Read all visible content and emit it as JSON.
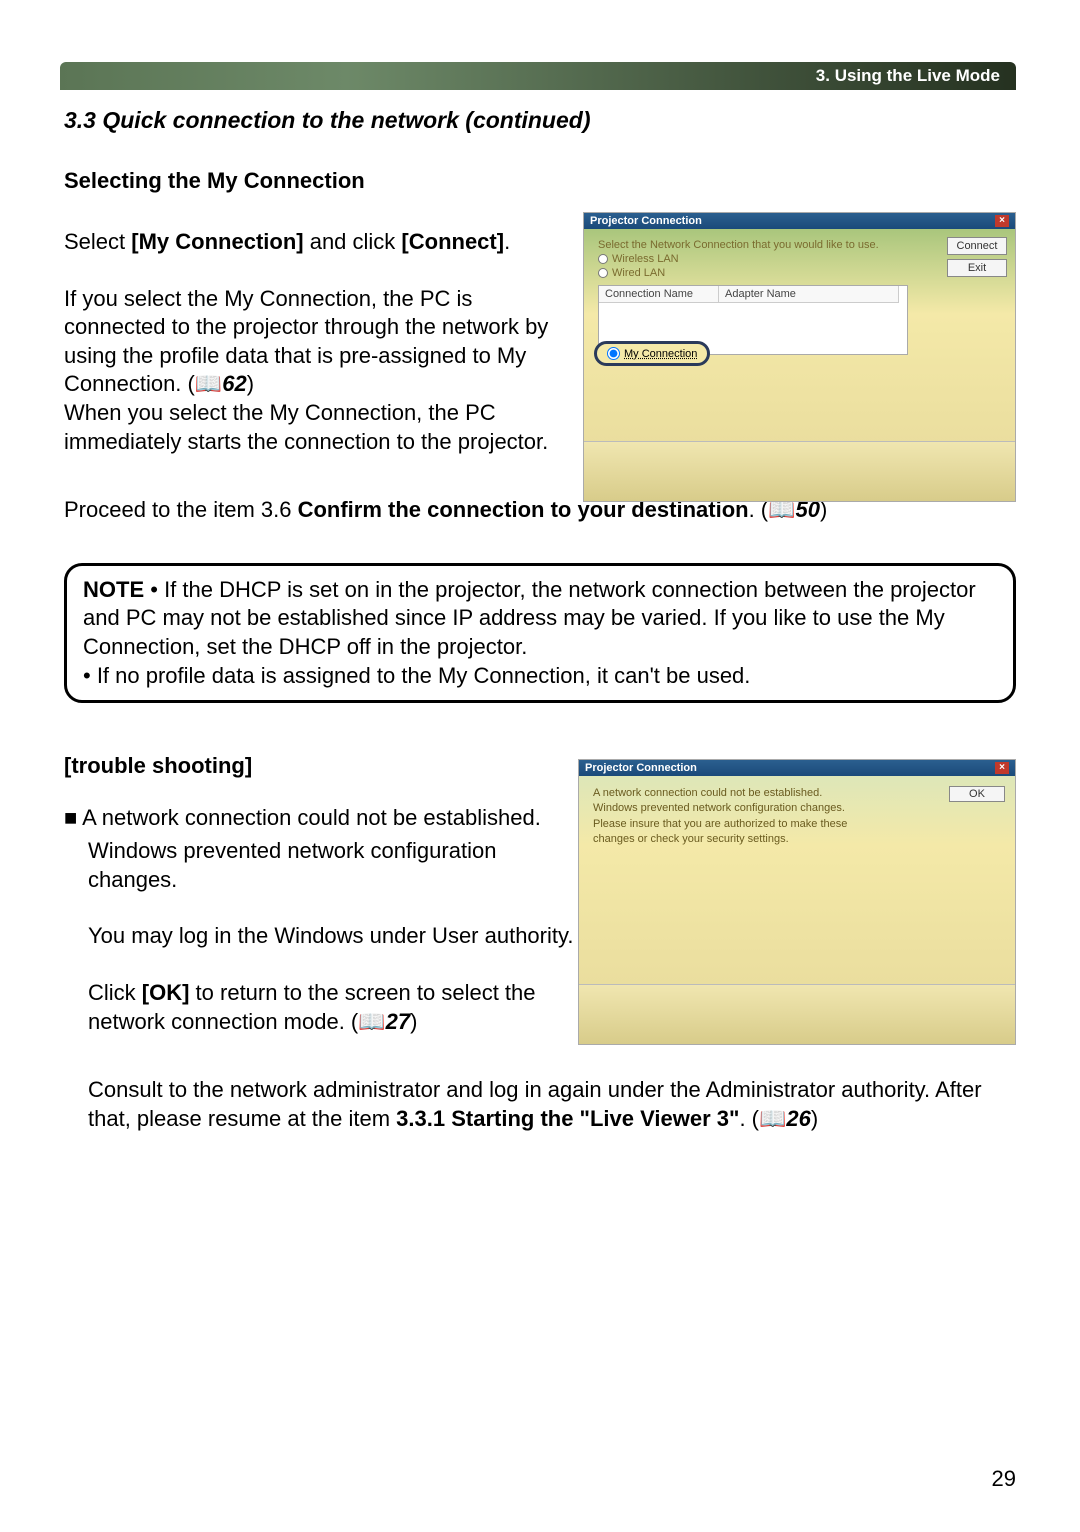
{
  "header": {
    "chapter": "3. Using the Live Mode"
  },
  "section": {
    "title": "3.3 Quick connection to the network (continued)",
    "subtitle": "Selecting the My Connection"
  },
  "para1": {
    "intro_pre": "Select ",
    "intro_bold1": "[My Connection]",
    "intro_mid": " and click ",
    "intro_bold2": "[Connect]",
    "intro_end": "."
  },
  "para2": {
    "text": "If you select the My Connection, the PC is connected to the projector through the network by using the profile data that is pre-assigned to My Connection. (",
    "ref": "62",
    "text2": ")\nWhen you select the My Connection, the PC immediately starts the connection to the projector."
  },
  "para3": {
    "pre": "Proceed to the item 3.6 ",
    "bold": "Confirm the connection to your destination",
    "post": ". (",
    "ref": "50",
    "end": ")"
  },
  "note": {
    "label": "NOTE",
    "bullet1": "• If the DHCP is set on in the projector, the network connection between the projector and PC may not be established since IP address may be varied. If you like to use the My Connection, set the DHCP off in the projector.",
    "bullet2": "• If no profile data is assigned to the My Connection, it can't be used."
  },
  "trouble": {
    "title": "[trouble shooting]",
    "heading": "■ A network connection could not be established.",
    "p1": "Windows prevented network configuration changes.",
    "p2": "You may log in the Windows under User authority.",
    "p3_pre": "Click ",
    "p3_bold": "[OK]",
    "p3_mid": " to return to the screen to select the network connection mode. (",
    "p3_ref": "27",
    "p3_end": ")",
    "p4_pre": "Consult to the network administrator and log in again under the Administrator authority. After that, please resume at the item ",
    "p4_bold": "3.3.1 Starting the \"Live Viewer 3\"",
    "p4_post": ". (",
    "p4_ref": "26",
    "p4_end": ")"
  },
  "page_number": "29",
  "screenshot1": {
    "title": "Projector Connection",
    "instruction": "Select the Network Connection that you would like to use.",
    "wireless": "Wireless LAN",
    "wired": "Wired LAN",
    "col1": "Connection Name",
    "col2": "Adapter Name",
    "myconn": "My Connection",
    "connect": "Connect",
    "exit": "Exit"
  },
  "screenshot2": {
    "title": "Projector Connection",
    "line1": "A network connection could not be established.",
    "line2": "Windows prevented network configuration changes.",
    "line3": "Please insure that you are authorized to make these",
    "line4": "changes or check your security settings.",
    "ok": "OK"
  }
}
